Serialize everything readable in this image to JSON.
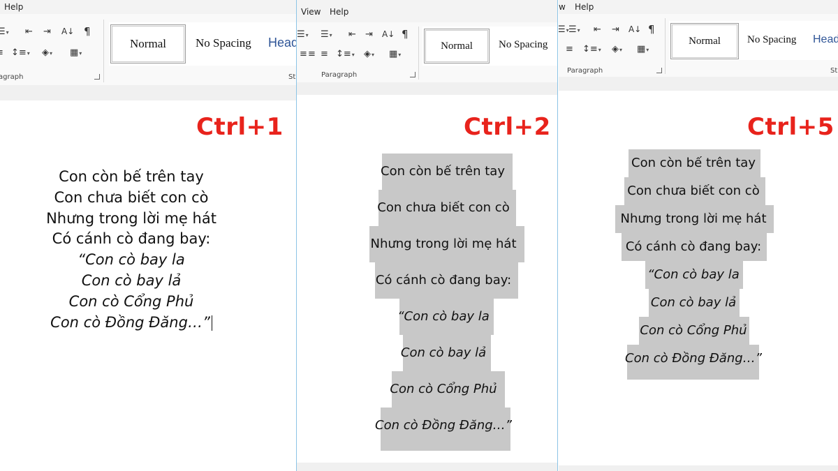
{
  "panels": [
    {
      "menu": [
        "Help"
      ],
      "paragraph_group_label": "agraph",
      "styles_group_label": "St",
      "style_gallery": [
        "Normal",
        "No Spacing",
        "Head"
      ],
      "shortcut": "Ctrl+1",
      "poem": [
        "Con còn bế trên tay",
        "Con chưa biết con cò",
        "Nhưng trong lời mẹ hát",
        "Có cánh cò đang bay:",
        "“Con cò bay la",
        "Con cò bay lả",
        "Con cò Cổng Phủ",
        "Con cò Đồng Đăng…”"
      ]
    },
    {
      "menu": [
        "View",
        "Help"
      ],
      "paragraph_group_label": "Paragraph",
      "styles_group_label": "",
      "style_gallery": [
        "Normal",
        "No Spacing"
      ],
      "shortcut": "Ctrl+2",
      "poem": [
        "Con còn bế trên tay",
        "Con chưa biết con cò",
        "Nhưng trong lời mẹ hát",
        "Có cánh cò đang bay:",
        "“Con cò bay la",
        "Con cò bay lả",
        "Con cò Cổng Phủ",
        "Con cò Đồng Đăng…”"
      ]
    },
    {
      "menu": [
        "w",
        "Help"
      ],
      "paragraph_group_label": "Paragraph",
      "styles_group_label": "St",
      "style_gallery": [
        "Normal",
        "No Spacing",
        "Head"
      ],
      "shortcut": "Ctrl+5",
      "poem": [
        "Con còn bế trên tay",
        "Con chưa biết con cò",
        "Nhưng trong lời mẹ hát",
        "Có cánh cò đang bay:",
        "“Con cò bay la",
        "Con cò bay lả",
        "Con cò Cổng Phủ",
        "Con cò Đồng Đăng…”"
      ]
    }
  ],
  "icons": {
    "list": "☰",
    "sort": "A↓Z",
    "pilcrow": "¶",
    "indent": "⇤",
    "outdent": "⇥",
    "line_spacing": "↕",
    "shading": "◈",
    "borders": "▦",
    "align": "≡"
  },
  "colors": {
    "shortcut": "#e8231c",
    "highlight": "#c8c8c8",
    "heading_style": "#2f5597",
    "panel_divider": "#8cc4e6"
  }
}
